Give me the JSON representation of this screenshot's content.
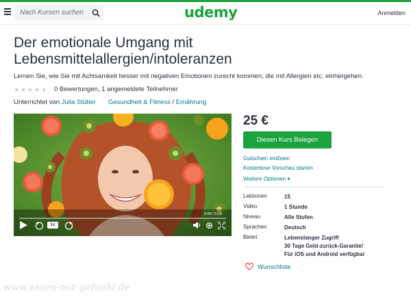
{
  "header": {
    "search_placeholder": "Nach Kursen suchen",
    "logo": "udemy",
    "login": "Anmelden",
    "brand_color": "#1aa33f"
  },
  "course": {
    "title": "Der emotionale Umgang mit Lebensmittelallergien/intoleranzen",
    "subtitle": "Lernen Sie, wie Sie mit Achtsamkeit besser mit negativen Emotionen zurecht kommen, die mit Allergien etc. einhergehen.",
    "rating_stars": 0,
    "rating_text": "0 Bewertungen, 1 angemeldete Teilnehmer",
    "instructor_prefix": "Unterrichtet von",
    "instructor": "Julia Stüber",
    "category": "Gesundheit & Fitness",
    "category_sep": "/",
    "subcategory": "Ernährung"
  },
  "video": {
    "time": "0:00 / 2:24",
    "speed": "1x",
    "progress": 0
  },
  "sidebar": {
    "price": "25 €",
    "buy_label": "Diesen Kurs Belegen",
    "coupon": "Gutschein einlösen",
    "preview": "Kostenlose Vorschau starten",
    "more_options": "Weitere Optionen ▾",
    "details": [
      {
        "key": "Lektionen",
        "value": "15"
      },
      {
        "key": "Video",
        "value": "1 Stunde"
      },
      {
        "key": "Niveau",
        "value": "Alle Stufen"
      },
      {
        "key": "Sprachen",
        "value": "Deutsch"
      },
      {
        "key": "Bietet",
        "value": "Lebenslanger Zugriff"
      }
    ],
    "offers_extra": [
      "30 Tage Geld-zurück-Garantie!",
      "Für iOS und Android verfügbar"
    ],
    "wishlist": "Wunschliste"
  },
  "watermark": "www.essen-mit-gefuehl.de"
}
